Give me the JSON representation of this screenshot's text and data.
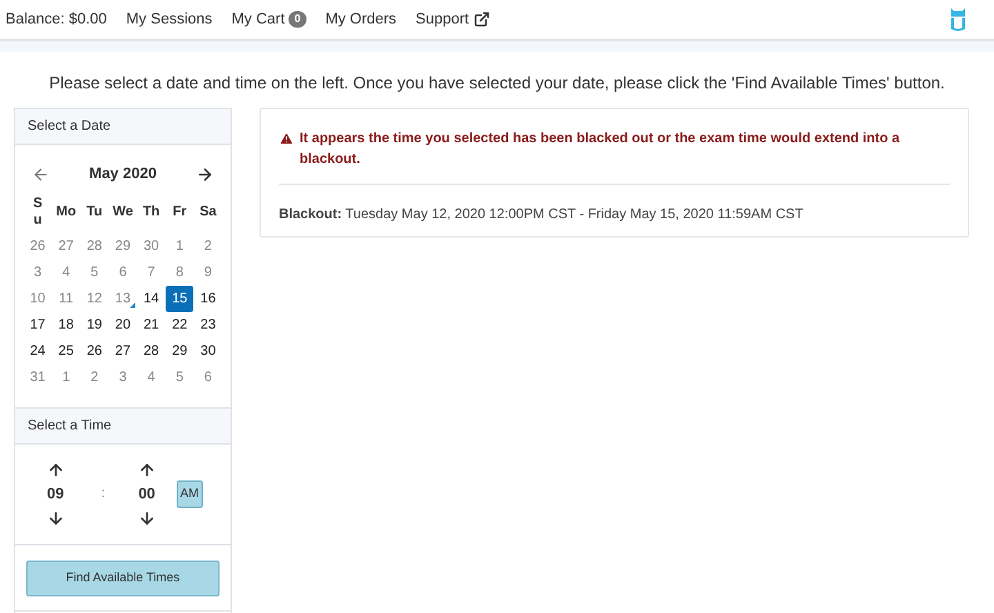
{
  "nav": {
    "balance": "Balance: $0.00",
    "links": [
      {
        "label": "My Sessions",
        "kind": "plain"
      },
      {
        "label": "My Cart",
        "kind": "badge",
        "badge": "0"
      },
      {
        "label": "My Orders",
        "kind": "plain"
      },
      {
        "label": "Support",
        "kind": "external"
      }
    ]
  },
  "instructions": "Please select a date and time on the left. Once you have selected your date, please click the 'Find Available Times' button.",
  "date_panel": {
    "title": "Select a Date",
    "month": "May 2020",
    "weekdays": [
      "Su",
      "Mo",
      "Tu",
      "We",
      "Th",
      "Fr",
      "Sa"
    ],
    "days": [
      {
        "label": "26",
        "muted": true,
        "selected": false,
        "today": false
      },
      {
        "label": "27",
        "muted": true,
        "selected": false,
        "today": false
      },
      {
        "label": "28",
        "muted": true,
        "selected": false,
        "today": false
      },
      {
        "label": "29",
        "muted": true,
        "selected": false,
        "today": false
      },
      {
        "label": "30",
        "muted": true,
        "selected": false,
        "today": false
      },
      {
        "label": "1",
        "muted": true,
        "selected": false,
        "today": false
      },
      {
        "label": "2",
        "muted": true,
        "selected": false,
        "today": false
      },
      {
        "label": "3",
        "muted": true,
        "selected": false,
        "today": false
      },
      {
        "label": "4",
        "muted": true,
        "selected": false,
        "today": false
      },
      {
        "label": "5",
        "muted": true,
        "selected": false,
        "today": false
      },
      {
        "label": "6",
        "muted": true,
        "selected": false,
        "today": false
      },
      {
        "label": "7",
        "muted": true,
        "selected": false,
        "today": false
      },
      {
        "label": "8",
        "muted": true,
        "selected": false,
        "today": false
      },
      {
        "label": "9",
        "muted": true,
        "selected": false,
        "today": false
      },
      {
        "label": "10",
        "muted": true,
        "selected": false,
        "today": false
      },
      {
        "label": "11",
        "muted": true,
        "selected": false,
        "today": false
      },
      {
        "label": "12",
        "muted": true,
        "selected": false,
        "today": false
      },
      {
        "label": "13",
        "muted": true,
        "selected": false,
        "today": true
      },
      {
        "label": "14",
        "muted": false,
        "selected": false,
        "today": false
      },
      {
        "label": "15",
        "muted": false,
        "selected": true,
        "today": false
      },
      {
        "label": "16",
        "muted": false,
        "selected": false,
        "today": false
      },
      {
        "label": "17",
        "muted": false,
        "selected": false,
        "today": false
      },
      {
        "label": "18",
        "muted": false,
        "selected": false,
        "today": false
      },
      {
        "label": "19",
        "muted": false,
        "selected": false,
        "today": false
      },
      {
        "label": "20",
        "muted": false,
        "selected": false,
        "today": false
      },
      {
        "label": "21",
        "muted": false,
        "selected": false,
        "today": false
      },
      {
        "label": "22",
        "muted": false,
        "selected": false,
        "today": false
      },
      {
        "label": "23",
        "muted": false,
        "selected": false,
        "today": false
      },
      {
        "label": "24",
        "muted": false,
        "selected": false,
        "today": false
      },
      {
        "label": "25",
        "muted": false,
        "selected": false,
        "today": false
      },
      {
        "label": "26",
        "muted": false,
        "selected": false,
        "today": false
      },
      {
        "label": "27",
        "muted": false,
        "selected": false,
        "today": false
      },
      {
        "label": "28",
        "muted": false,
        "selected": false,
        "today": false
      },
      {
        "label": "29",
        "muted": false,
        "selected": false,
        "today": false
      },
      {
        "label": "30",
        "muted": false,
        "selected": false,
        "today": false
      },
      {
        "label": "31",
        "muted": true,
        "selected": false,
        "today": false
      },
      {
        "label": "1",
        "muted": true,
        "selected": false,
        "today": false
      },
      {
        "label": "2",
        "muted": true,
        "selected": false,
        "today": false
      },
      {
        "label": "3",
        "muted": true,
        "selected": false,
        "today": false
      },
      {
        "label": "4",
        "muted": true,
        "selected": false,
        "today": false
      },
      {
        "label": "5",
        "muted": true,
        "selected": false,
        "today": false
      },
      {
        "label": "6",
        "muted": true,
        "selected": false,
        "today": false
      }
    ]
  },
  "time_panel": {
    "title": "Select a Time",
    "hour": "09",
    "separator": ":",
    "minute": "00",
    "meridiem": "AM"
  },
  "find_button": "Find Available Times",
  "alert": {
    "message": "It appears the time you selected has been blacked out or the exam time would extend into a blackout.",
    "detail_label": "Blackout:",
    "detail": "Tuesday May 12, 2020 12:00PM CST - Friday May 15, 2020 11:59AM CST"
  }
}
